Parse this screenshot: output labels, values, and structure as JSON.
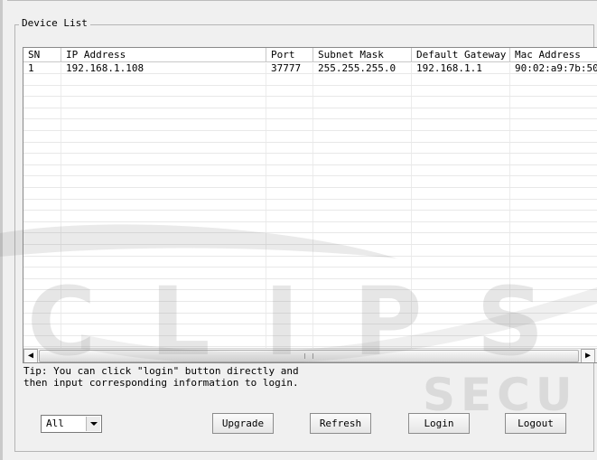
{
  "device_list": {
    "title": "Device List",
    "columns": [
      "SN",
      "IP Address",
      "Port",
      "Subnet Mask",
      "Default Gateway",
      "Mac Address"
    ],
    "rows": [
      [
        "1",
        "192.168.1.108",
        "37777",
        "255.255.255.0",
        "192.168.1.1",
        "90:02:a9:7b:50"
      ]
    ]
  },
  "tip": {
    "line1": "Tip: You can click \"login\" button directly and",
    "line2": "then input corresponding information to login."
  },
  "filter": {
    "value": "All"
  },
  "buttons": {
    "upgrade": "Upgrade",
    "refresh": "Refresh",
    "login": "Login",
    "logout": "Logout"
  },
  "watermark": {
    "main": "CLIPS",
    "sub": "SECU"
  },
  "icons": {
    "scroll_left": "triangle-left-icon",
    "scroll_right": "triangle-right-icon",
    "dropdown": "chevron-down-icon"
  }
}
